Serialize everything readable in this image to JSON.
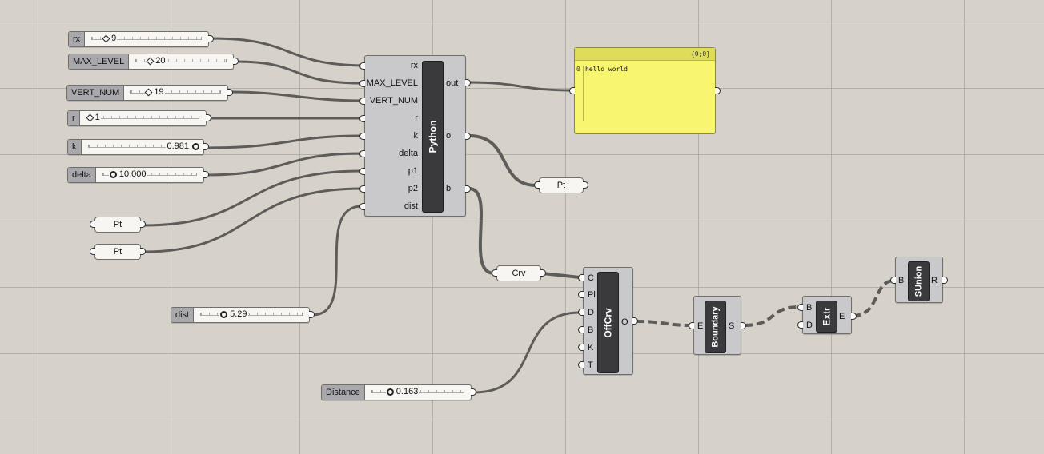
{
  "sliders": {
    "rx": {
      "label": "rx",
      "value": "9"
    },
    "max_level": {
      "label": "MAX_LEVEL",
      "value": "20"
    },
    "vert_num": {
      "label": "VERT_NUM",
      "value": "19"
    },
    "r": {
      "label": "r",
      "value": "1"
    },
    "k": {
      "label": "k",
      "value": "0.981"
    },
    "delta": {
      "label": "delta",
      "value": "10.000"
    },
    "dist": {
      "label": "dist",
      "value": "5.29"
    },
    "distance": {
      "label": "Distance",
      "value": "0.163"
    }
  },
  "params": {
    "pt_a": "Pt",
    "pt_b": "Pt",
    "pt_out": "Pt",
    "crv": "Crv"
  },
  "python": {
    "name": "Python",
    "inputs": [
      "rx",
      "MAX_LEVEL",
      "VERT_NUM",
      "r",
      "k",
      "delta",
      "p1",
      "p2",
      "dist"
    ],
    "outputs": [
      "out",
      "o",
      "b"
    ]
  },
  "panel": {
    "path": "{0;0}",
    "index": "0",
    "text": "hello world"
  },
  "offcrv": {
    "name": "OffCrv",
    "inputs": [
      "C",
      "Pl",
      "D",
      "B",
      "K",
      "T"
    ],
    "outputs": [
      "O"
    ]
  },
  "boundary": {
    "name": "Boundary",
    "inputs": [
      "E"
    ],
    "outputs": [
      "S"
    ]
  },
  "extr": {
    "name": "Extr",
    "inputs": [
      "B",
      "D"
    ],
    "outputs": [
      "E"
    ]
  },
  "sunion": {
    "name": "SUnion",
    "inputs": [
      "B"
    ],
    "outputs": [
      "R"
    ]
  }
}
